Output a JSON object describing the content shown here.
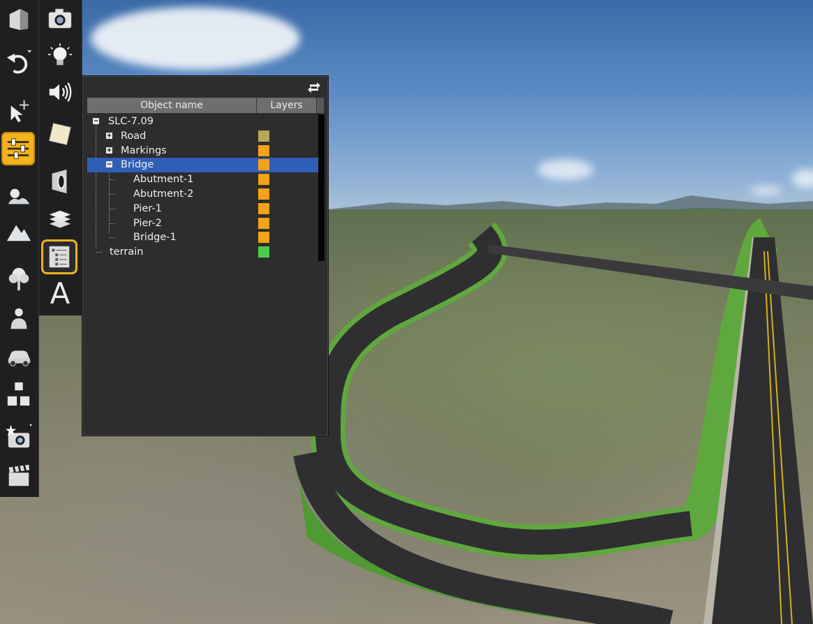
{
  "scene_panel": {
    "columns": {
      "name": "Object name",
      "layers": "Layers"
    },
    "tree": [
      {
        "label": "SLC-7.09",
        "expander": "minus",
        "level": 0,
        "layer_color": null,
        "selected": false
      },
      {
        "label": "Road",
        "expander": "plus",
        "level": 1,
        "layer_color": "#b7a85e",
        "selected": false
      },
      {
        "label": "Markings",
        "expander": "plus",
        "level": 1,
        "layer_color": "#f3a21a",
        "selected": false
      },
      {
        "label": "Bridge",
        "expander": "minus",
        "level": 1,
        "layer_color": "#f3a21a",
        "selected": true
      },
      {
        "label": "Abutment-1",
        "expander": null,
        "level": 2,
        "layer_color": "#f3a21a",
        "selected": false
      },
      {
        "label": "Abutment-2",
        "expander": null,
        "level": 2,
        "layer_color": "#f3a21a",
        "selected": false
      },
      {
        "label": "Pier-1",
        "expander": null,
        "level": 2,
        "layer_color": "#f3a21a",
        "selected": false
      },
      {
        "label": "Pier-2",
        "expander": null,
        "level": 2,
        "layer_color": "#f3a21a",
        "selected": false
      },
      {
        "label": "Bridge-1",
        "expander": null,
        "level": 2,
        "layer_color": "#f3a21a",
        "selected": false
      },
      {
        "label": "terrain",
        "expander": null,
        "level": 0,
        "layer_color": "#4ccd4a",
        "selected": false
      }
    ]
  },
  "toolbar_left": [
    {
      "icon": "buildings-icon",
      "active": false
    },
    {
      "icon": "undo-icon",
      "active": false
    },
    {
      "icon": "select-move-icon",
      "active": false
    },
    {
      "icon": "settings-sliders-icon",
      "active": true
    },
    {
      "icon": "weather-icon",
      "active": false
    },
    {
      "icon": "terrain-mountain-icon",
      "active": false
    },
    {
      "icon": "tree-icon",
      "active": false
    },
    {
      "icon": "person-icon",
      "active": false
    },
    {
      "icon": "car-icon",
      "active": false
    },
    {
      "icon": "hierarchy-icon",
      "active": false
    },
    {
      "icon": "snapshot-camera-icon",
      "active": false
    },
    {
      "icon": "clapperboard-icon",
      "active": false
    }
  ],
  "toolbar_right": [
    {
      "icon": "camera-icon",
      "active": false
    },
    {
      "icon": "lightbulb-icon",
      "active": false
    },
    {
      "icon": "speaker-icon",
      "active": false
    },
    {
      "icon": "material-icon",
      "active": false
    },
    {
      "icon": "viewpoint-icon",
      "active": false
    },
    {
      "icon": "layers-icon",
      "active": false
    },
    {
      "icon": "scene-list-icon",
      "active": true
    },
    {
      "icon": "text-icon",
      "active": false,
      "letter": "A"
    }
  ],
  "colors": {
    "accent": "#f3b21e",
    "selection": "#2f5fb6",
    "panel_bg": "#2d2d2d",
    "toolbar_bg": "#1f1f1f"
  }
}
